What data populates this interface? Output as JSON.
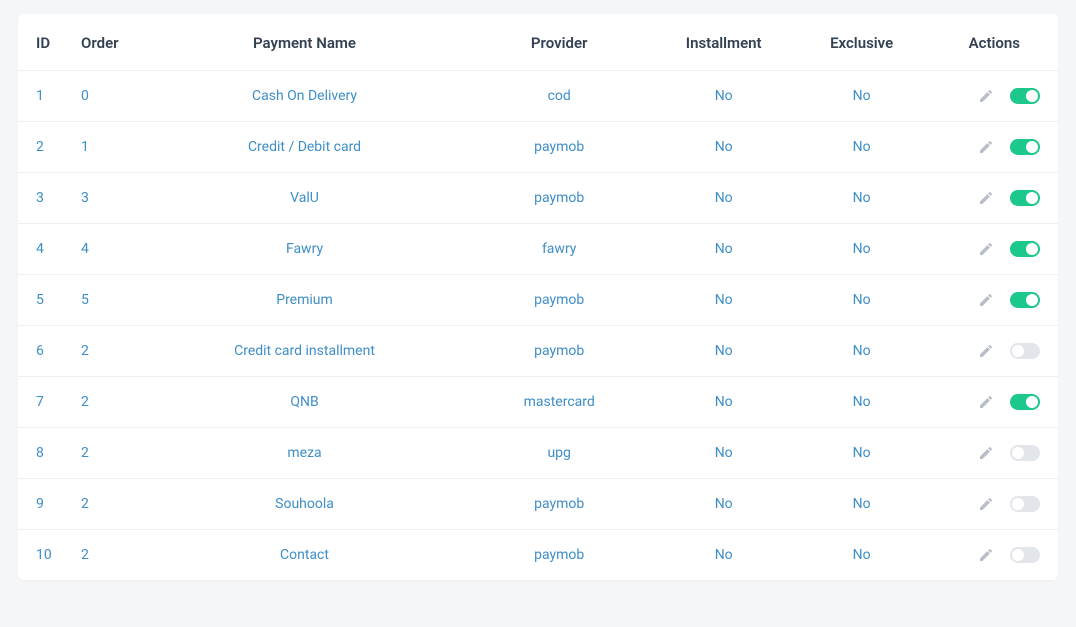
{
  "table": {
    "headers": {
      "id": "ID",
      "order": "Order",
      "name": "Payment Name",
      "provider": "Provider",
      "installment": "Installment",
      "exclusive": "Exclusive",
      "actions": "Actions"
    },
    "rows": [
      {
        "id": "1",
        "order": "0",
        "name": "Cash On Delivery",
        "provider": "cod",
        "installment": "No",
        "exclusive": "No",
        "enabled": true
      },
      {
        "id": "2",
        "order": "1",
        "name": "Credit / Debit card",
        "provider": "paymob",
        "installment": "No",
        "exclusive": "No",
        "enabled": true
      },
      {
        "id": "3",
        "order": "3",
        "name": "ValU",
        "provider": "paymob",
        "installment": "No",
        "exclusive": "No",
        "enabled": true
      },
      {
        "id": "4",
        "order": "4",
        "name": "Fawry",
        "provider": "fawry",
        "installment": "No",
        "exclusive": "No",
        "enabled": true
      },
      {
        "id": "5",
        "order": "5",
        "name": "Premium",
        "provider": "paymob",
        "installment": "No",
        "exclusive": "No",
        "enabled": true
      },
      {
        "id": "6",
        "order": "2",
        "name": "Credit card installment",
        "provider": "paymob",
        "installment": "No",
        "exclusive": "No",
        "enabled": false
      },
      {
        "id": "7",
        "order": "2",
        "name": "QNB",
        "provider": "mastercard",
        "installment": "No",
        "exclusive": "No",
        "enabled": true
      },
      {
        "id": "8",
        "order": "2",
        "name": "meza",
        "provider": "upg",
        "installment": "No",
        "exclusive": "No",
        "enabled": false
      },
      {
        "id": "9",
        "order": "2",
        "name": "Souhoola",
        "provider": "paymob",
        "installment": "No",
        "exclusive": "No",
        "enabled": false
      },
      {
        "id": "10",
        "order": "2",
        "name": "Contact",
        "provider": "paymob",
        "installment": "No",
        "exclusive": "No",
        "enabled": false
      }
    ]
  },
  "icons": {
    "edit": "edit-icon"
  },
  "colors": {
    "link": "#3e8ec7",
    "toggle_on": "#1cc88a",
    "toggle_off": "#e2e5ea",
    "icon_muted": "#b8bec8"
  }
}
